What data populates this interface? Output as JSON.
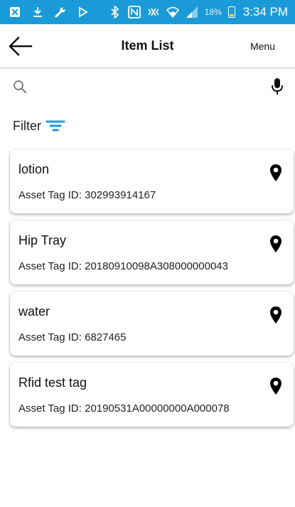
{
  "status_bar": {
    "icons": [
      "notification-box-icon",
      "download-icon",
      "wrench-icon",
      "play-icon",
      "bluetooth-icon",
      "nfc-icon",
      "vibrate-icon",
      "wifi-icon",
      "signal-icon"
    ],
    "battery_percent": "18%",
    "time": "3:34 PM",
    "color": "#1a9bd7"
  },
  "header": {
    "title": "Item List",
    "menu_label": "Menu",
    "back_icon": "arrow-left-icon"
  },
  "search": {
    "placeholder": "",
    "value": "",
    "icon": "search-icon",
    "mic_icon": "microphone-icon"
  },
  "filter": {
    "label": "Filter",
    "icon": "filter-icon",
    "accent": "#1a9bd7"
  },
  "items": [
    {
      "name": "lotion",
      "asset_tag": "Asset Tag ID: 302993914167",
      "icon": "location-pin-icon"
    },
    {
      "name": "Hip Tray",
      "asset_tag": "Asset Tag ID: 20180910098A308000000043",
      "icon": "location-pin-icon"
    },
    {
      "name": "water",
      "asset_tag": "Asset Tag ID: 6827465",
      "icon": "location-pin-icon"
    },
    {
      "name": "Rfid test tag",
      "asset_tag": "Asset Tag ID: 20190531A00000000A000078",
      "icon": "location-pin-icon"
    }
  ]
}
